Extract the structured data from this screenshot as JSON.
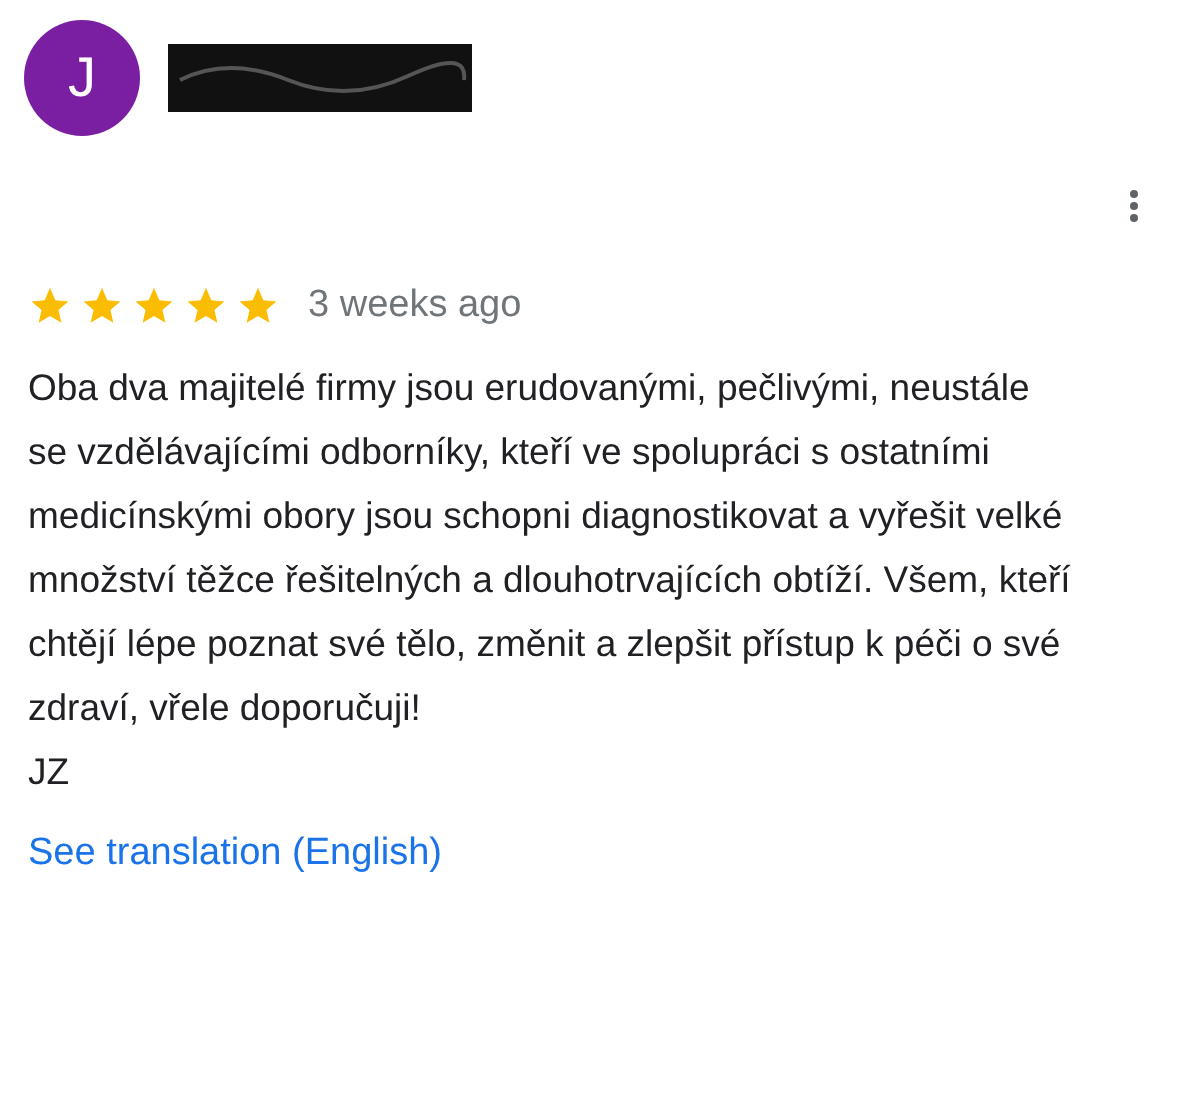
{
  "author": {
    "initial": "J"
  },
  "review": {
    "stars": 5,
    "time": "3 weeks ago",
    "text": "Oba dva majitelé firmy jsou erudovanými, pečlivými, neustále se vzdělávajícími odborníky, kteří ve spolupráci s ostatními medicínskými obory jsou schopni diagnostikovat a vyřešit velké množství těžce řešitelných a dlouhotrvajících obtíží. Všem, kteří chtějí lépe poznat své tělo, změnit a zlepšit přístup k péči o své zdraví, vřele doporučuji!\nJZ",
    "link": "See translation (English)"
  }
}
